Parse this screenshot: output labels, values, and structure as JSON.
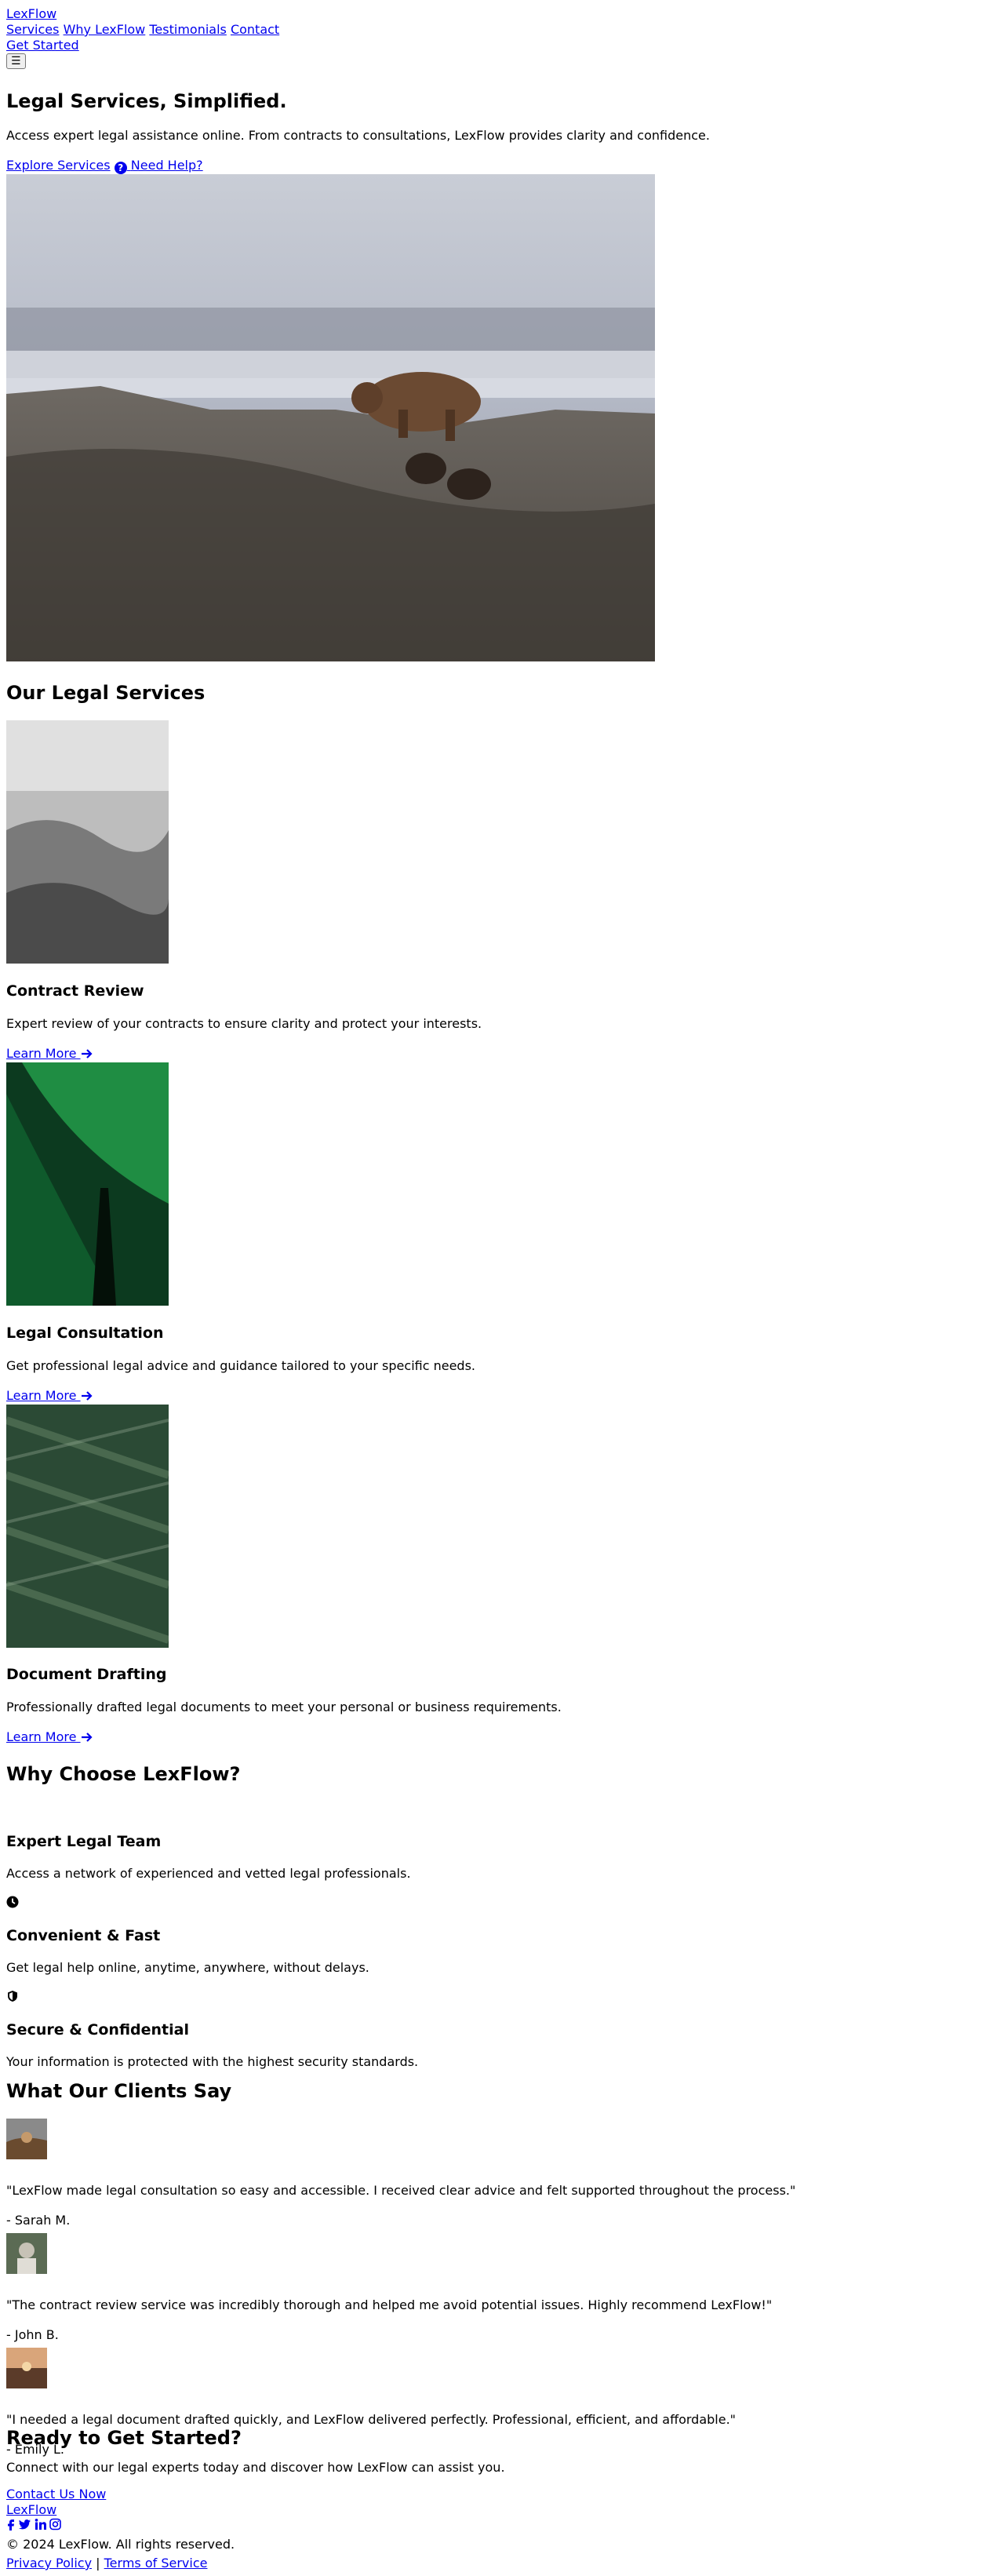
{
  "header": {
    "brand": "LexFlow",
    "nav": [
      "Services",
      "Why LexFlow",
      "Testimonials",
      "Contact"
    ],
    "cta": "Get Started",
    "menu_icon": "☰"
  },
  "hero": {
    "title": "Legal Services, Simplified.",
    "subtitle": "Access expert legal assistance online. From contracts to consultations, LexFlow provides clarity and confidence.",
    "primary_link": "Explore Services",
    "secondary_link": "Need Help?"
  },
  "services": {
    "heading": "Our Legal Services",
    "items": [
      {
        "title": "Contract Review",
        "description": "Expert review of your contracts to ensure clarity and protect your interests.",
        "link": "Learn More"
      },
      {
        "title": "Legal Consultation",
        "description": "Get professional legal advice and guidance tailored to your specific needs.",
        "link": "Learn More"
      },
      {
        "title": "Document Drafting",
        "description": "Professionally drafted legal documents to meet your personal or business requirements.",
        "link": "Learn More"
      }
    ]
  },
  "why": {
    "heading": "Why Choose LexFlow?",
    "items": [
      {
        "title": "Expert Legal Team",
        "description": "Access a network of experienced and vetted legal professionals.",
        "icon": "none"
      },
      {
        "title": "Convenient & Fast",
        "description": "Get legal help online, anytime, anywhere, without delays.",
        "icon": "clock-icon"
      },
      {
        "title": "Secure & Confidential",
        "description": "Your information is protected with the highest security standards.",
        "icon": "shield-icon"
      }
    ]
  },
  "testimonials": {
    "heading": "What Our Clients Say",
    "items": [
      {
        "quote": "\"LexFlow made legal consultation so easy and accessible. I received clear advice and felt supported throughout the process.\"",
        "author": "- Sarah M."
      },
      {
        "quote": "\"The contract review service was incredibly thorough and helped me avoid potential issues. Highly recommend LexFlow!\"",
        "author": "- John B."
      },
      {
        "quote": "\"I needed a legal document drafted quickly, and LexFlow delivered perfectly. Professional, efficient, and affordable.\"",
        "author": "- Emily L."
      }
    ]
  },
  "cta": {
    "heading": "Ready to Get Started?",
    "text": "Connect with our legal experts today and discover how LexFlow can assist you.",
    "link": "Contact Us Now"
  },
  "footer": {
    "brand": "LexFlow",
    "social": [
      "facebook-icon",
      "twitter-icon",
      "linkedin-icon",
      "instagram-icon"
    ],
    "copyright": "© 2024 LexFlow. All rights reserved.",
    "links": [
      "Privacy Policy",
      "Terms of Service"
    ],
    "separator": "|"
  },
  "colors": {
    "link": "#0000ee",
    "text": "#000000"
  }
}
